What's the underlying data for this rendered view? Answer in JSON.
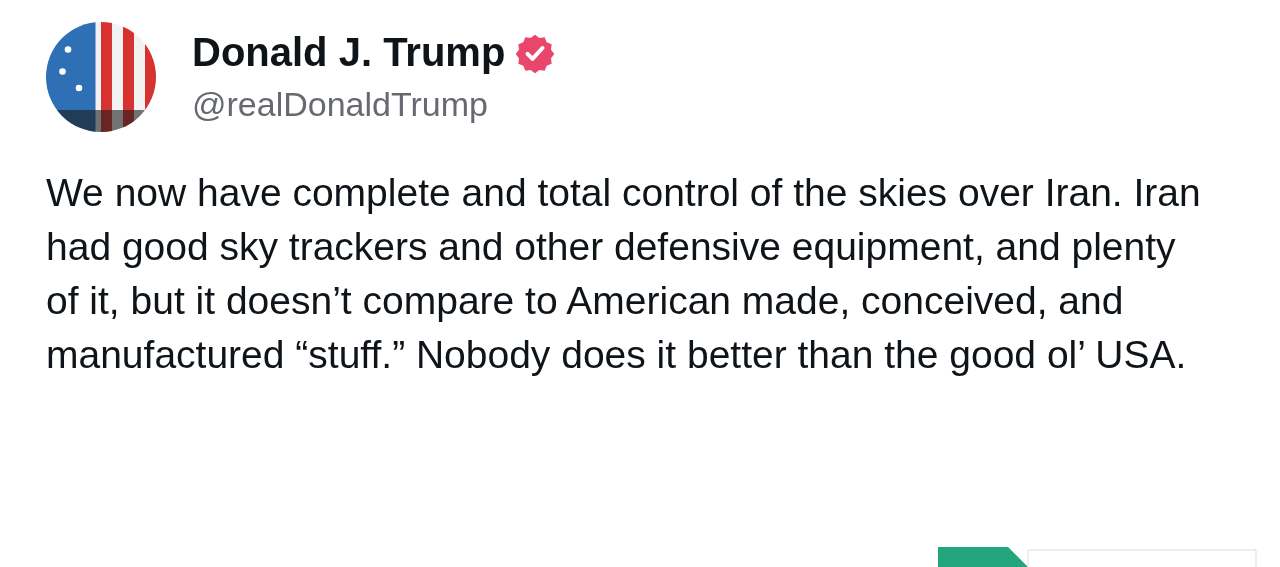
{
  "author": {
    "name": "Donald J. Trump",
    "verified": true,
    "handle": "@realDonaldTrump"
  },
  "post": {
    "text": "We now have complete and total control of the skies over Iran. Iran had good sky trackers and other defensive equipment, and plenty of it, but it doesn’t compare to American made, conceived, and manufactured “stuff.” Nobody does it better than the good ol’ USA."
  }
}
